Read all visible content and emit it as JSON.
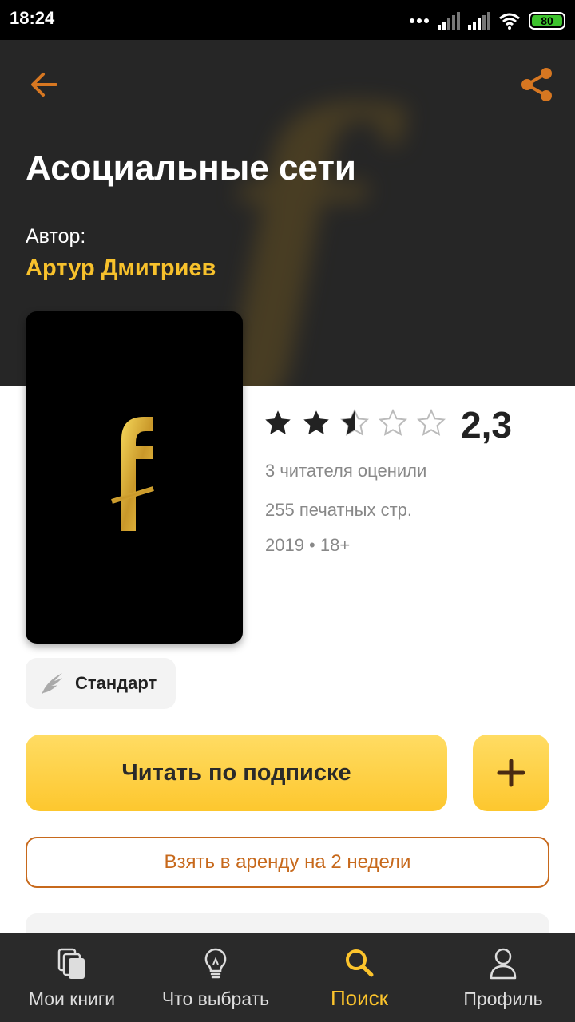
{
  "status_bar": {
    "time": "18:24",
    "battery": "80"
  },
  "book": {
    "title": "Асоциальные сети",
    "author_label": "Автор:",
    "author_name": "Артур Дмитриев",
    "cover_letter": "f",
    "rating": {
      "value_text": "2,3",
      "value": 2.3,
      "max": 5
    },
    "ratings_count": "3 читателя оценили",
    "pages": "255 печатных стр.",
    "year_age": "2019 • 18+",
    "badge": "Стандарт"
  },
  "actions": {
    "read": "Читать по подписке",
    "rent": "Взять в аренду на 2 недели"
  },
  "nav": {
    "items": [
      {
        "label": "Мои книги",
        "icon": "books-icon"
      },
      {
        "label": "Что выбрать",
        "icon": "lightbulb-icon"
      },
      {
        "label": "Поиск",
        "icon": "search-icon"
      },
      {
        "label": "Профиль",
        "icon": "profile-icon"
      }
    ],
    "active": 2
  },
  "colors": {
    "accent": "#fcc42c",
    "author": "#f7c12c",
    "rent_border": "#c7691c",
    "header_bg": "#262626",
    "nav_bg": "#2a2a2a"
  }
}
